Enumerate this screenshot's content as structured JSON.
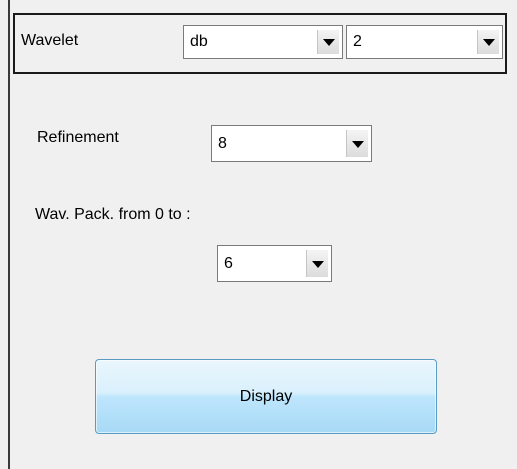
{
  "wavelet": {
    "label": "Wavelet",
    "family": {
      "value": "db",
      "icon": "chevron-down-icon"
    },
    "order": {
      "value": "2",
      "icon": "chevron-down-icon"
    }
  },
  "refinement": {
    "label": "Refinement",
    "value": "8"
  },
  "wavpack": {
    "label": "Wav. Pack. from 0 to :",
    "value": "6"
  },
  "display_button": {
    "label": "Display"
  },
  "colors": {
    "button_top": "#eaf6fd",
    "button_bottom": "#a7d9f5",
    "button_border": "#5a9bc4",
    "panel_bg": "#f0f0f0"
  }
}
